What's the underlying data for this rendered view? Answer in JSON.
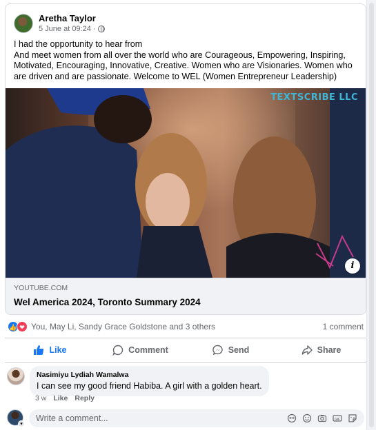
{
  "post": {
    "author": "Aretha Taylor",
    "date": "5 June at 09:24",
    "separator": "·",
    "text_line1": "I had the opportunity to hear from",
    "text_line2": "And meet women from all over the world who are Courageous, Empowering, Inspiring, Motivated, Encouraging, Innovative, Creative. Women who are Visionaries. Women who are driven and are passionate. Welcome to WEL (Women Entrepreneur Leadership)"
  },
  "link": {
    "watermark": "TEXTSCRIBE LLC",
    "info_glyph": "i",
    "domain": "YOUTUBE.COM",
    "title": "Wel America 2024, Toronto Summary 2024"
  },
  "reactions": {
    "names": "You, May Li, Sandy Grace Goldstone and 3 others",
    "comment_count": "1 comment"
  },
  "actions": {
    "like": "Like",
    "comment": "Comment",
    "send": "Send",
    "share": "Share"
  },
  "comment": {
    "author": "Nasimiyu Lydiah Wamalwa",
    "text": "I can see my good friend Habiba. A girl with a golden heart.",
    "age": "3 w",
    "like": "Like",
    "reply": "Reply"
  },
  "composer": {
    "placeholder": "Write a comment..."
  },
  "icons": {
    "author_avatar": "avatar",
    "privacy": "globe-icon",
    "info": "info-icon",
    "reaction_like": "thumbs-up-icon",
    "reaction_love": "heart-icon",
    "action_like": "thumbs-up-icon",
    "action_comment": "speech-bubble-icon",
    "action_send": "messenger-icon",
    "action_share": "share-arrow-icon",
    "composer": [
      "avatar-sticker-icon",
      "emoji-icon",
      "camera-icon",
      "gif-icon",
      "sticker-icon"
    ]
  },
  "colors": {
    "accent": "#1877f2",
    "love": "#f33e58",
    "watermark": "#3fb6d8",
    "muted_text": "#65676b",
    "bubble_bg": "#f0f2f5"
  }
}
